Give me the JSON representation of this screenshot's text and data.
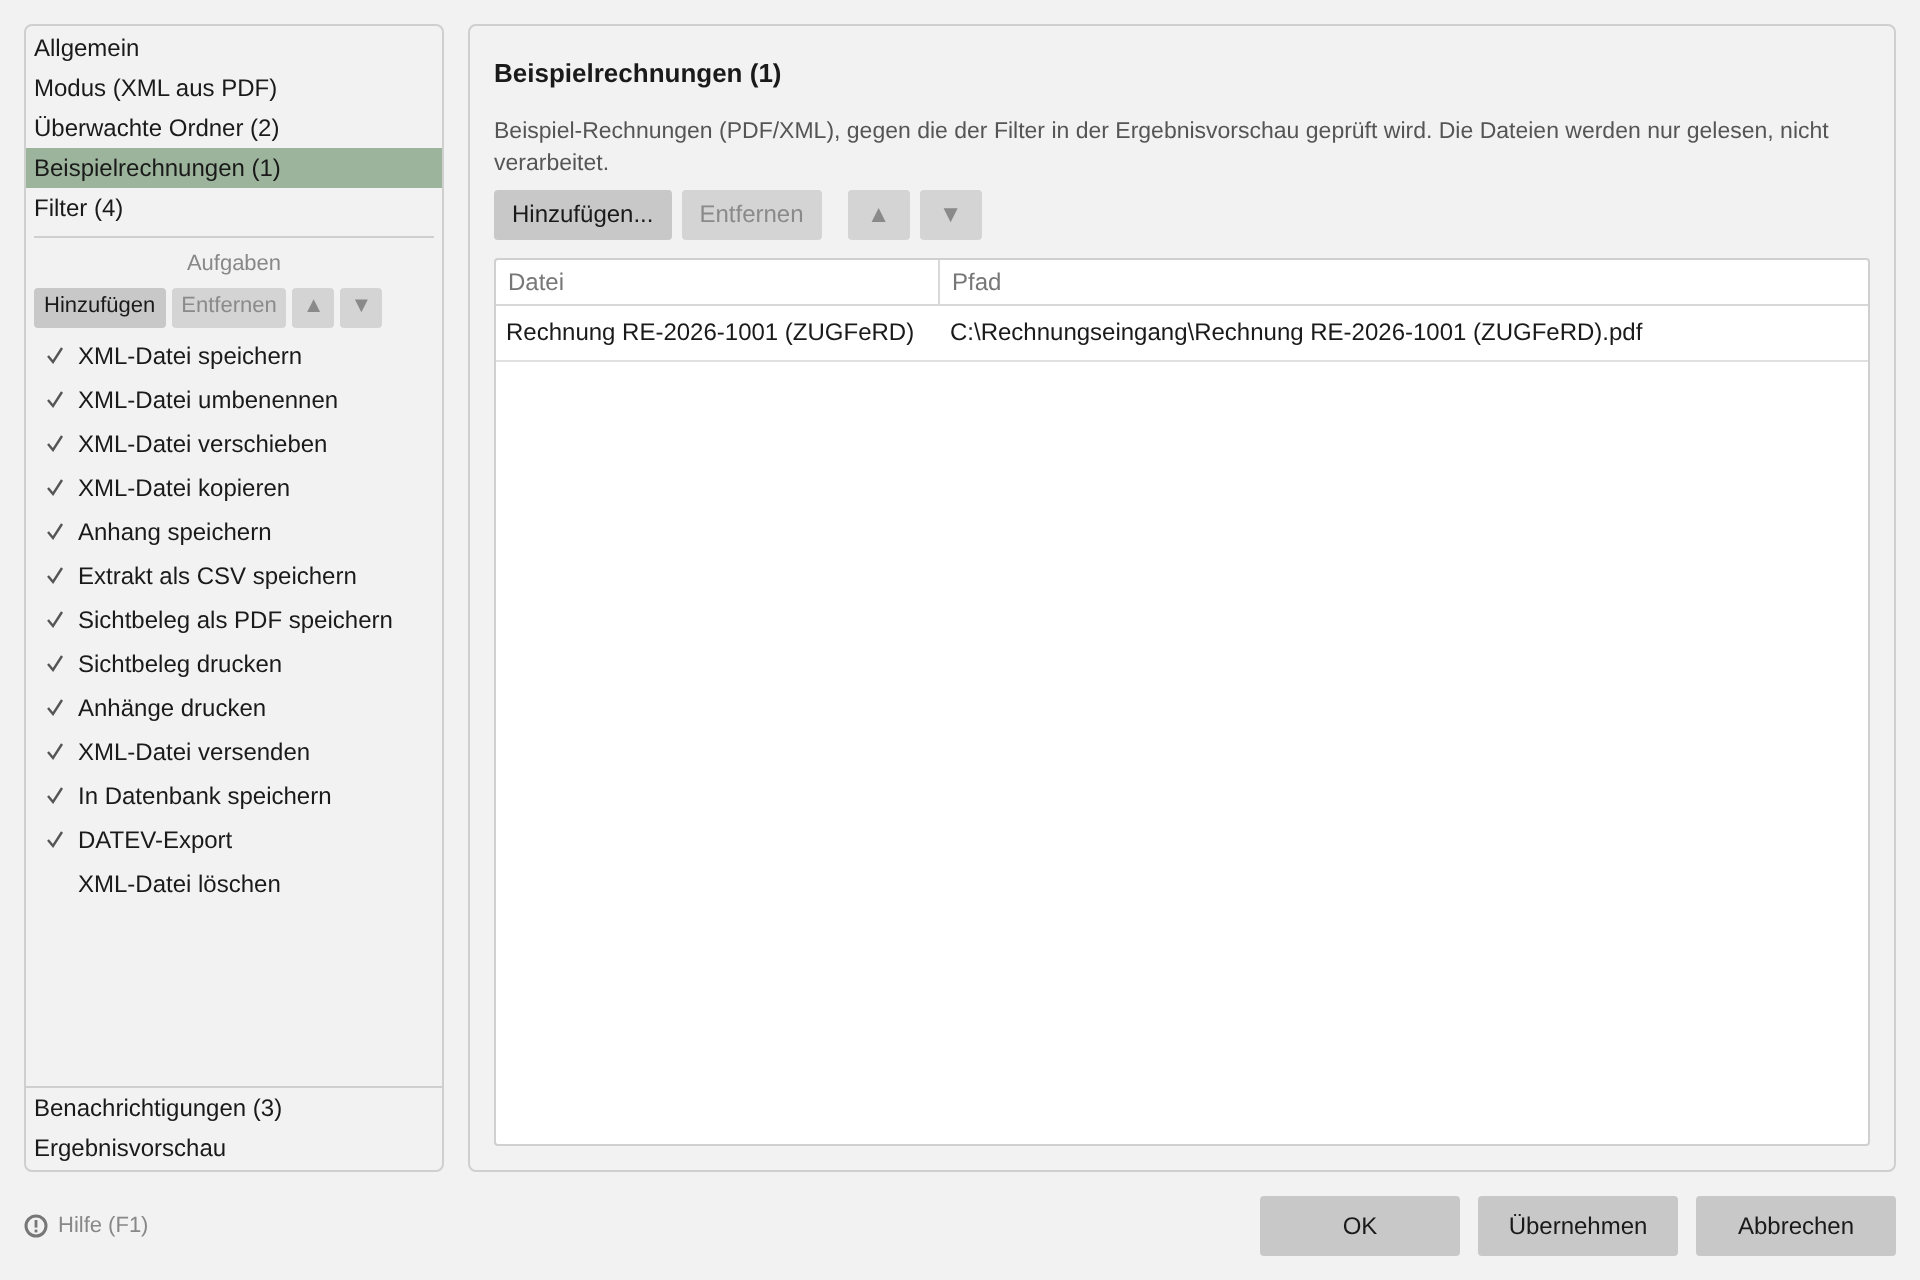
{
  "sidebar": {
    "nav_items": [
      {
        "label": "Allgemein",
        "selected": false
      },
      {
        "label": "Modus (XML aus PDF)",
        "selected": false
      },
      {
        "label": "Überwachte Ordner (2)",
        "selected": false
      },
      {
        "label": "Beispielrechnungen (1)",
        "selected": true
      },
      {
        "label": "Filter (4)",
        "selected": false
      }
    ],
    "tasks_heading": "Aufgaben",
    "task_buttons": [
      {
        "label": "Hinzufügen",
        "disabled": false
      },
      {
        "label": "Entfernen",
        "disabled": true
      },
      {
        "label": "▲",
        "disabled": true
      },
      {
        "label": "▼",
        "disabled": true
      }
    ],
    "tasks": [
      {
        "label": "XML-Datei speichern",
        "checked": true
      },
      {
        "label": "XML-Datei umbenennen",
        "checked": true
      },
      {
        "label": "XML-Datei verschieben",
        "checked": true
      },
      {
        "label": "XML-Datei kopieren",
        "checked": true
      },
      {
        "label": "Anhang speichern",
        "checked": true
      },
      {
        "label": "Extrakt als CSV speichern",
        "checked": true
      },
      {
        "label": "Sichtbeleg als PDF speichern",
        "checked": true
      },
      {
        "label": "Sichtbeleg drucken",
        "checked": true
      },
      {
        "label": "Anhänge drucken",
        "checked": true
      },
      {
        "label": "XML-Datei versenden",
        "checked": true
      },
      {
        "label": "In Datenbank speichern",
        "checked": true
      },
      {
        "label": "DATEV-Export",
        "checked": true
      },
      {
        "label": "XML-Datei löschen",
        "checked": false
      }
    ],
    "bottom_items": [
      {
        "label": "Benachrichtigungen (3)",
        "selected": false
      },
      {
        "label": "Ergebnisvorschau",
        "selected": false
      }
    ]
  },
  "panel": {
    "title": "Beispielrechnungen (1)",
    "description": "Beispiel-Rechnungen (PDF/XML), gegen die der Filter in der Ergebnisvorschau geprüft wird. Die Dateien werden nur gelesen, nicht verarbeitet.",
    "buttons": [
      {
        "label": "Hinzufügen...",
        "disabled": false
      },
      {
        "label": "Entfernen",
        "disabled": true
      },
      {
        "label": "▲",
        "disabled": true
      },
      {
        "label": "▼",
        "disabled": true
      }
    ],
    "table": {
      "columns": [
        "Datei",
        "Pfad"
      ],
      "rows": [
        [
          "Rechnung RE-2026-1001 (ZUGFeRD)",
          "C:\\Rechnungseingang\\Rechnung RE-2026-1001 (ZUGFeRD).pdf"
        ]
      ]
    }
  },
  "help": "Hilfe (F1)",
  "dialog_buttons": [
    "OK",
    "Übernehmen",
    "Abbrechen"
  ]
}
